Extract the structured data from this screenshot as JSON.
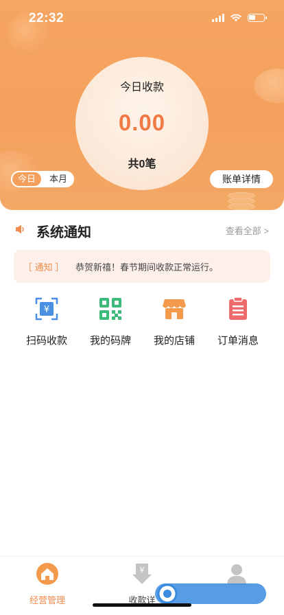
{
  "status_bar": {
    "time": "22:32"
  },
  "summary": {
    "title": "今日收款",
    "amount": "0.00",
    "count": "共0笔",
    "period_tabs": [
      {
        "label": "今日",
        "active": true
      },
      {
        "label": "本月",
        "active": false
      }
    ],
    "bill_details_label": "账单详情"
  },
  "notice": {
    "section_title": "系统通知",
    "view_all_label": "查看全部 >",
    "tag": "［ 通知 ］",
    "text": "恭贺新禧！春节期间收款正常运行。"
  },
  "actions": [
    {
      "label": "扫码收款",
      "icon": "scan-yuan-icon"
    },
    {
      "label": "我的码牌",
      "icon": "qr-code-icon"
    },
    {
      "label": "我的店铺",
      "icon": "store-icon"
    },
    {
      "label": "订单消息",
      "icon": "order-list-icon"
    }
  ],
  "tabbar": [
    {
      "label": "经营管理",
      "icon": "home-icon",
      "active": true
    },
    {
      "label": "收款详",
      "icon": "payment-download-icon",
      "active": false
    },
    {
      "label": "",
      "icon": "user-profile-icon",
      "active": false
    }
  ],
  "colors": {
    "accent": "#f4a05c",
    "amount": "#f07a44",
    "notice_bg": "#fdf0ea"
  }
}
